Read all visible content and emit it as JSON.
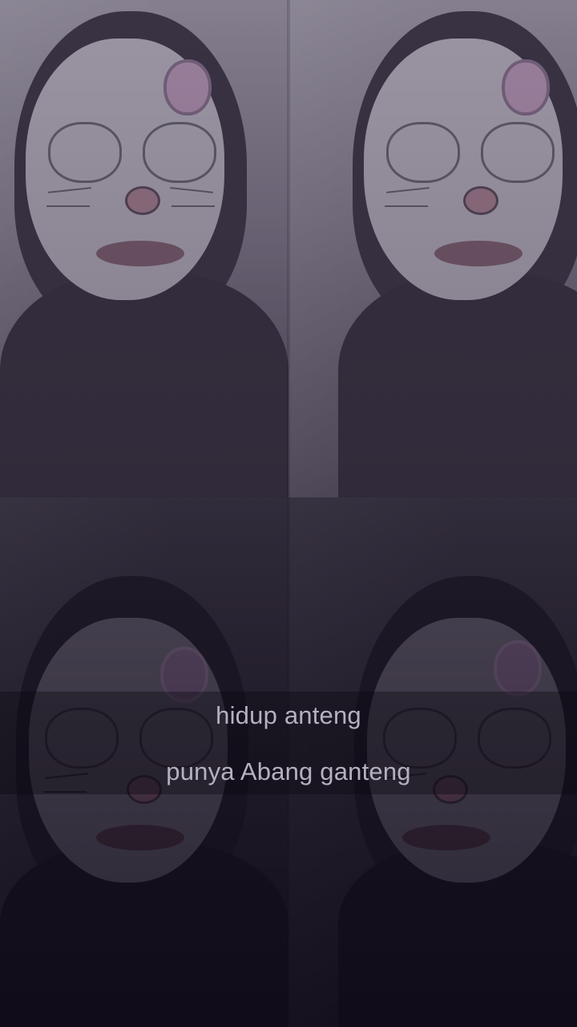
{
  "video": {
    "lyrics": {
      "line1": "hidup anteng",
      "line2": "punya Abang ganteng"
    },
    "grid_layout": "2x2",
    "filter_icons": [
      "cat-face-filter",
      "bow-icon"
    ],
    "colors": {
      "caption_text": "#b6b0bf",
      "overlay_tint": "#2a2236"
    }
  }
}
